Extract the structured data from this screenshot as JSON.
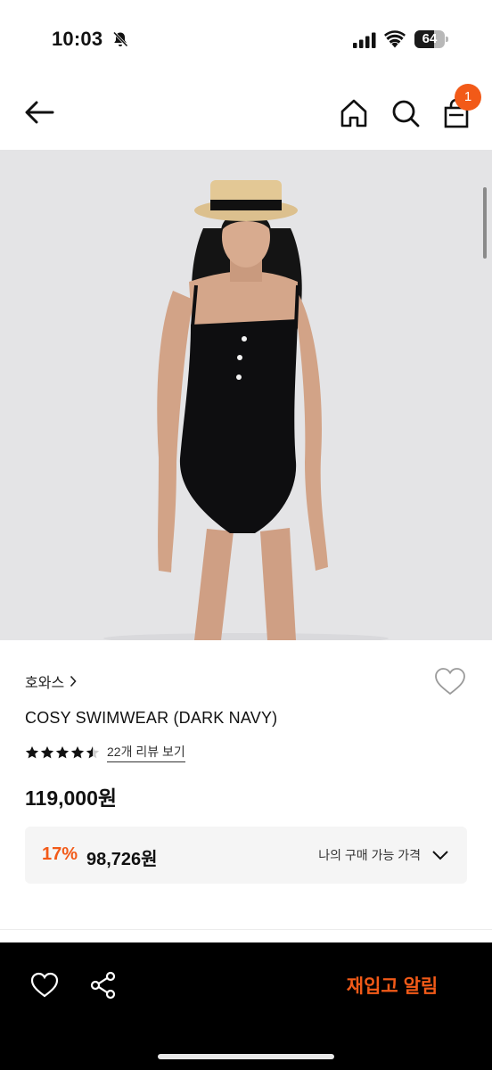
{
  "status_bar": {
    "time": "10:03",
    "battery_text": "64",
    "battery_level": 0.64,
    "icons": [
      "bell-slash-icon",
      "signal-icon",
      "wifi-icon",
      "battery-icon"
    ]
  },
  "header": {
    "icons": [
      "back-arrow-icon",
      "home-icon",
      "search-icon",
      "shopping-bag-icon"
    ],
    "cart_count": "1"
  },
  "product": {
    "brand": "호와스",
    "name": "COSY SWIMWEAR (DARK NAVY)",
    "rating": 4.5,
    "review_text": "22개 리뷰 보기",
    "price": "119,000원",
    "discount_rate": "17%",
    "member_price": "98,726원",
    "my_price_label": "나의 구매 가능 가격"
  },
  "bottom_bar": {
    "icons": [
      "heart-icon",
      "share-icon"
    ],
    "restock_label": "재입고 알림"
  },
  "colors": {
    "accent": "#f25a18",
    "bottom_bar": "#000000",
    "image_bg": "#e4e4e6"
  }
}
